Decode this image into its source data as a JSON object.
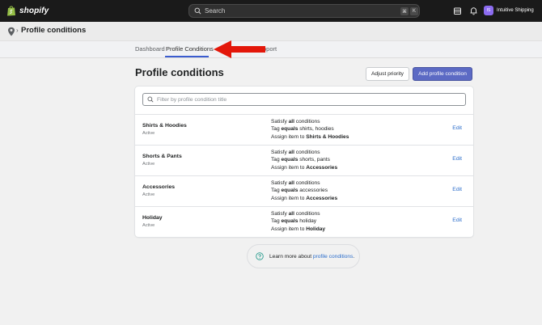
{
  "topbar": {
    "brand": "shopify",
    "search_placeholder": "Search",
    "shortcut_keys": [
      "⌘",
      "K"
    ],
    "store_initials": "IS",
    "store_name": "Intuitive Shipping"
  },
  "appbar": {
    "separator": "›",
    "title": "Profile conditions"
  },
  "tabs": [
    {
      "label": "Dashboard",
      "active": false
    },
    {
      "label": "Profile Conditions",
      "active": true
    },
    {
      "label": "Support",
      "visible_fragment": "pport",
      "active": false
    }
  ],
  "main": {
    "title": "Profile conditions",
    "adjust_priority_label": "Adjust priority",
    "add_condition_label": "Add profile condition",
    "filter_placeholder": "Filter by profile condition title",
    "rows": [
      {
        "name": "Shirts & Hoodies",
        "status": "Active",
        "line1_pre": "Satisfy ",
        "line1_bold": "all",
        "line1_post": " conditions",
        "line2_pre": "Tag ",
        "line2_bold": "equals",
        "line2_post": " shirts, hoodies",
        "line3_pre": "Assign item to ",
        "line3_bold": "Shirts & Hoodies",
        "edit": "Edit"
      },
      {
        "name": "Shorts & Pants",
        "status": "Active",
        "line1_pre": "Satisfy ",
        "line1_bold": "all",
        "line1_post": " conditions",
        "line2_pre": "Tag ",
        "line2_bold": "equals",
        "line2_post": " shorts, pants",
        "line3_pre": "Assign item to ",
        "line3_bold": "Accessories",
        "edit": "Edit"
      },
      {
        "name": "Accessories",
        "status": "Active",
        "line1_pre": "Satisfy ",
        "line1_bold": "all",
        "line1_post": " conditions",
        "line2_pre": "Tag ",
        "line2_bold": "equals",
        "line2_post": " accessories",
        "line3_pre": "Assign item to ",
        "line3_bold": "Accessories",
        "edit": "Edit"
      },
      {
        "name": "Holiday",
        "status": "Active",
        "line1_pre": "Satisfy ",
        "line1_bold": "all",
        "line1_post": " conditions",
        "line2_pre": "Tag ",
        "line2_bold": "equals",
        "line2_post": " holiday",
        "line3_pre": "Assign item to ",
        "line3_bold": "Holiday",
        "edit": "Edit"
      }
    ],
    "learn_text": "Learn more about ",
    "learn_link": "profile conditions",
    "learn_suffix": "."
  },
  "colors": {
    "topbar": "#1a1a1a",
    "primary_button": "#5c6ac4",
    "link": "#2c6ecb",
    "annotation_arrow": "#e3170a",
    "store_avatar": "#8c6cf0"
  },
  "icons": [
    "shopify-bag-icon",
    "search-icon",
    "shop-icon",
    "bell-icon",
    "location-pin-icon",
    "help-circle-icon",
    "red-annotation-arrow"
  ]
}
